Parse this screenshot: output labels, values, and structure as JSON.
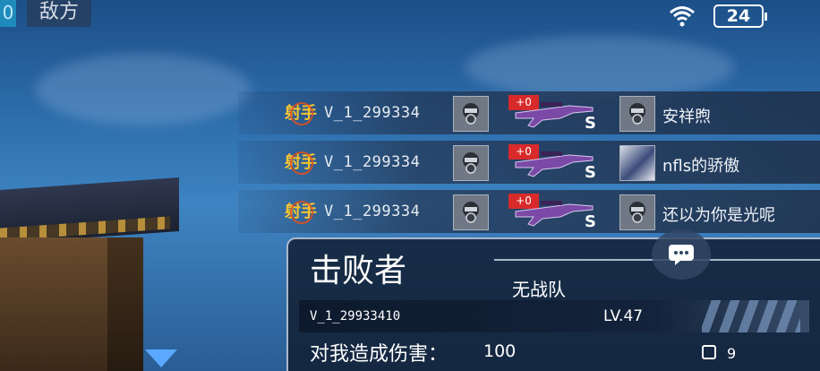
{
  "status_bar": {
    "battery": "24"
  },
  "top_left": {
    "team_tag": "0",
    "enemy_label": "敌方"
  },
  "kill_feed": [
    {
      "killer_badge": "射手",
      "killer": "V_1_299334",
      "weapon_bonus": "+0",
      "weapon_grade": "S",
      "victim": "安祥煦",
      "victim_avatar": "gas-mask-avatar"
    },
    {
      "killer_badge": "射手",
      "killer": "V_1_299334",
      "weapon_bonus": "+0",
      "weapon_grade": "S",
      "victim": "nfls的骄傲",
      "victim_avatar": "photo-avatar"
    },
    {
      "killer_badge": "射手",
      "killer": "V_1_299334",
      "weapon_bonus": "+0",
      "weapon_grade": "S",
      "victim": "还以为你是光呢",
      "victim_avatar": "gas-mask-avatar"
    }
  ],
  "killer_panel": {
    "title": "击败者",
    "team": "无战队",
    "player_id": "V_1_29933410",
    "level": "LV.47",
    "damage_label": "对我造成伤害：",
    "damage_value": "100",
    "hit_count": "9"
  },
  "colors": {
    "accent_red": "#d82a2a",
    "badge_gold": "#f7c531",
    "panel_border": "#aab9cc"
  }
}
